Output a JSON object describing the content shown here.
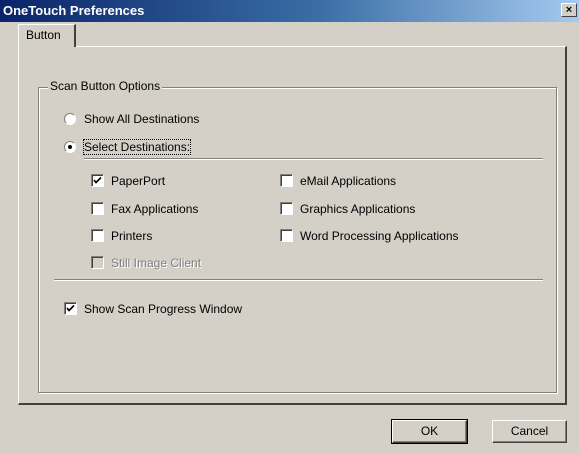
{
  "window": {
    "title": "OneTouch Preferences",
    "close_glyph": "×"
  },
  "tabs": [
    {
      "label": "Button",
      "selected": true
    }
  ],
  "group": {
    "legend": "Scan Button Options",
    "radios": [
      {
        "label": "Show All Destinations",
        "checked": false
      },
      {
        "label": "Select Destinations:",
        "checked": true
      }
    ],
    "destinations_left": [
      {
        "label": "PaperPort",
        "checked": true,
        "enabled": true
      },
      {
        "label": "Fax Applications",
        "checked": false,
        "enabled": true
      },
      {
        "label": "Printers",
        "checked": false,
        "enabled": true
      },
      {
        "label": "Still Image Client",
        "checked": false,
        "enabled": false
      }
    ],
    "destinations_right": [
      {
        "label": "eMail Applications",
        "checked": false,
        "enabled": true
      },
      {
        "label": "Graphics Applications",
        "checked": false,
        "enabled": true
      },
      {
        "label": "Word Processing Applications",
        "checked": false,
        "enabled": true
      }
    ],
    "progress": {
      "label": "Show Scan Progress Window",
      "checked": true
    }
  },
  "buttons": {
    "ok": "OK",
    "cancel": "Cancel"
  }
}
